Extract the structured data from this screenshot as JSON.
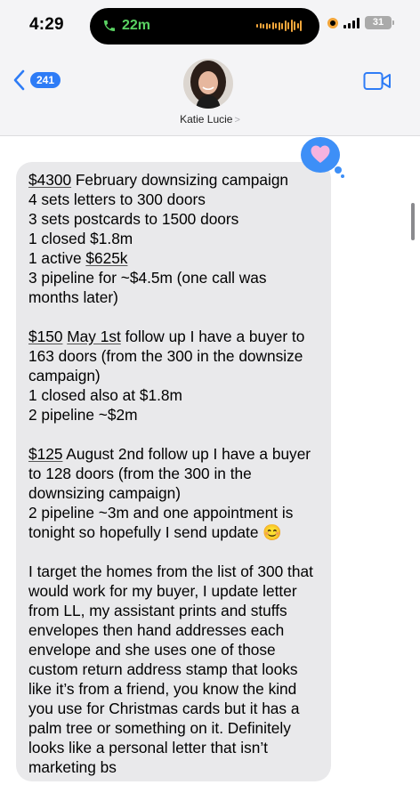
{
  "status_bar": {
    "time": "4:29",
    "call_duration": "22m",
    "battery_level": "31",
    "call_color": "#5ad363",
    "recording_color": "#f3a63b"
  },
  "nav": {
    "back_icon": "chevron-left-icon",
    "unread_count": "241",
    "contact_name": "Katie Lucie",
    "contact_chevron": ">",
    "video_icon": "video-camera-icon",
    "accent": "#2e7cf6"
  },
  "conversation": {
    "reaction": {
      "icon": "heart-icon",
      "color": "#3d8ff7"
    },
    "message": {
      "block1": {
        "amount": "$4300",
        "rest": " February downsizing campaign\n4 sets letters to 300 doors\n3 sets postcards to 1500 doors\n1 closed $1.8m\n1 active ",
        "active_amount": "$625k",
        "tail": "\n3 pipeline for ~$4.5m (one call was months later)"
      },
      "block2": {
        "amount": "$150",
        "date": "May 1st",
        "rest": " follow up I have a buyer to 163 doors (from the 300 in the downsize campaign)\n1 closed also at $1.8m\n2 pipeline ~$2m"
      },
      "block3": {
        "amount": "$125",
        "rest": " August 2nd follow up I have a buyer to 128 doors (from the 300 in the downsizing campaign)\n2 pipeline ~3m and one appointment is tonight so hopefully I send update ",
        "emoji": "😊"
      },
      "block4": "I target the homes from the list of 300 that would work for my buyer, I update letter from LL, my assistant prints and stuffs envelopes then hand addresses each envelope and she uses one of those custom return address stamp that looks like it’s from a friend, you know the kind you use for Christmas cards but it has a palm tree or something on it. Definitely looks like a personal letter that isn’t marketing bs"
    },
    "bubble_color": "#e9e9eb"
  }
}
